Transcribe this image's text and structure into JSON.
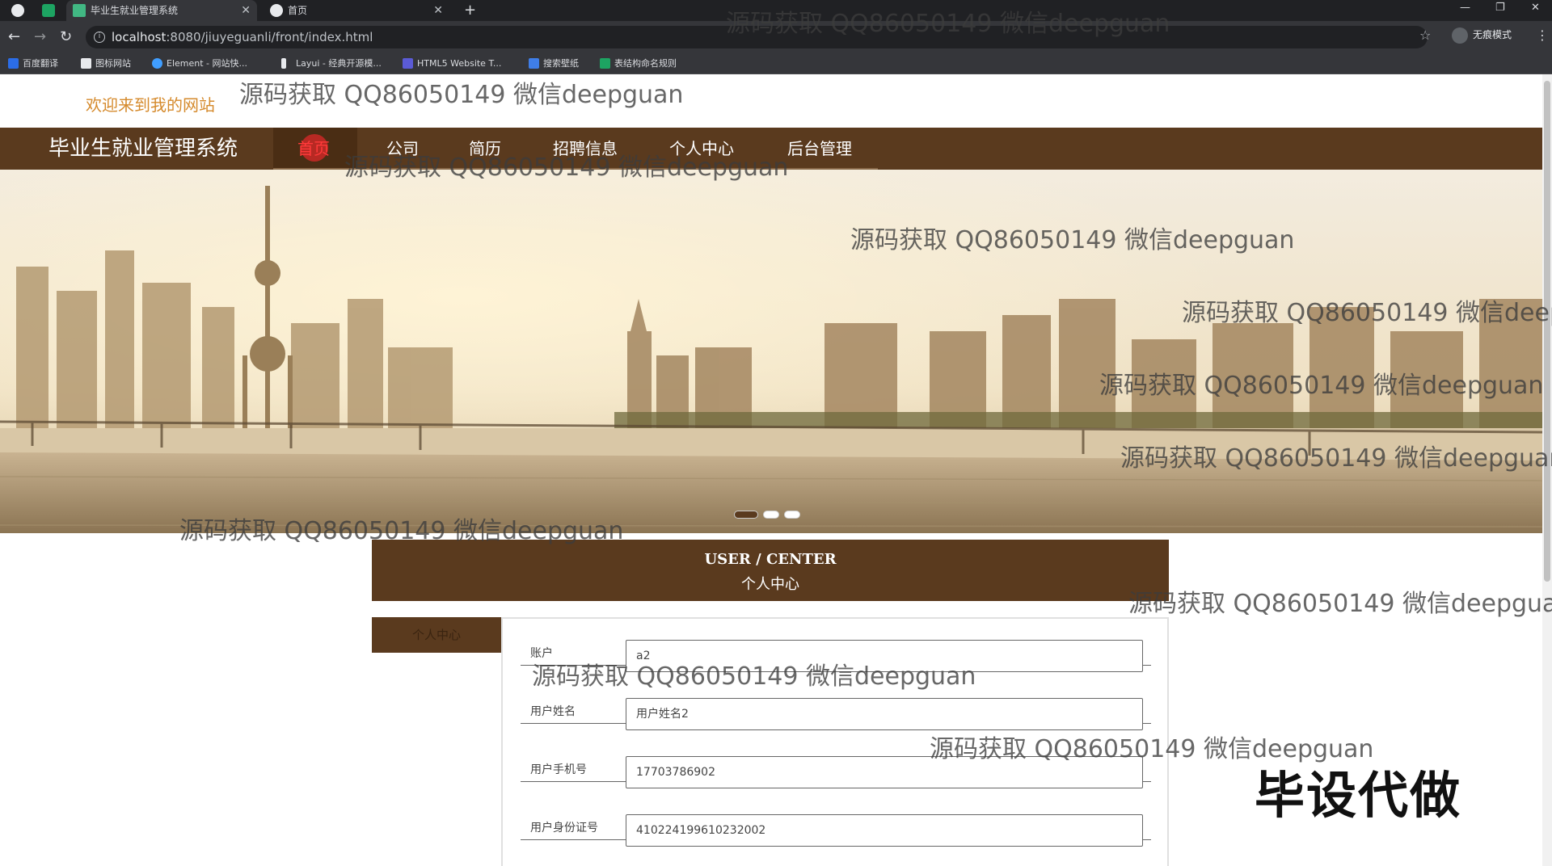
{
  "browser": {
    "tabs": [
      {
        "title": "毕业生就业管理系统",
        "active": true
      },
      {
        "title": "首页",
        "active": false
      }
    ],
    "address": {
      "host": "localhost",
      "rest": ":8080/jiuyeguanli/front/index.html"
    },
    "profile_label": "无痕模式",
    "bookmarks": [
      {
        "label": "百度翻译",
        "color": "#2b6de8"
      },
      {
        "label": "图标网站",
        "color": "#e8eaed"
      },
      {
        "label": "Element - 网站快...",
        "color": "#409eff"
      },
      {
        "label": "Layui - 经典开源模...",
        "color": "#e8eaed"
      },
      {
        "label": "HTML5 Website T...",
        "color": "#5b5bd6"
      },
      {
        "label": "搜索壁纸",
        "color": "#3f7ee8"
      },
      {
        "label": "表结构命名规则",
        "color": "#1da462"
      }
    ]
  },
  "site": {
    "welcome": "欢迎来到我的网站",
    "brand": "毕业生就业管理系统",
    "nav": [
      {
        "label": "首页",
        "active": true
      },
      {
        "label": "公司",
        "active": false
      },
      {
        "label": "简历",
        "active": false
      },
      {
        "label": "招聘信息",
        "active": false
      },
      {
        "label": "个人中心",
        "active": false
      },
      {
        "label": "后台管理",
        "active": false
      }
    ],
    "carousel_active_index": 0,
    "carousel_count": 3,
    "user_center": {
      "title_en": "USER / CENTER",
      "title_cn": "个人中心"
    },
    "side_menu": [
      "个人中心"
    ],
    "form": [
      {
        "label": "账户",
        "value": "a2"
      },
      {
        "label": "用户姓名",
        "value": "用户姓名2"
      },
      {
        "label": "用户手机号",
        "value": "17703786902"
      },
      {
        "label": "用户身份证号",
        "value": "410224199610232002"
      }
    ]
  },
  "overlays": {
    "watermark": "源码获取 QQ86050149 微信deepguan",
    "stamp": "毕设代做"
  },
  "colors": {
    "brand_brown": "#5a3a1e",
    "welcome_orange": "#d58a2c",
    "nav_active_red": "#ff3a3a"
  }
}
